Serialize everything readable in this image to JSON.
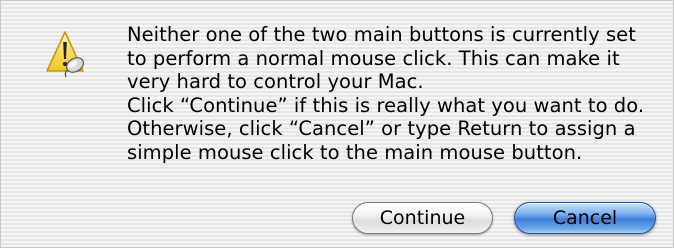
{
  "alert": {
    "icon": "caution-icon",
    "message": "Neither one of the two main buttons is currently set\nto perform a normal mouse click. This can make it\nvery hard to control your Mac.\nClick “Continue” if this is really what you want to do.\nOtherwise, click “Cancel” or type Return to assign a\nsimple mouse click to the main mouse button."
  },
  "buttons": {
    "continue_label": "Continue",
    "cancel_label": "Cancel",
    "default_color": "#3d7ed8"
  }
}
